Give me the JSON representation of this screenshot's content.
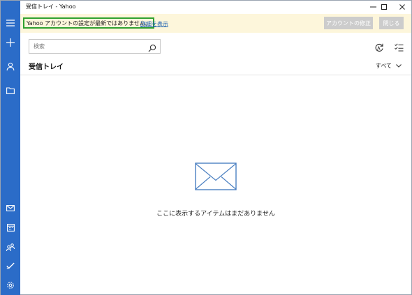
{
  "window": {
    "title": "受信トレイ - Yahoo"
  },
  "rail": {
    "top_icons": [
      "hamburger-icon",
      "plus-icon",
      "person-icon",
      "folder-icon"
    ],
    "bottom_icons": [
      "mail-icon",
      "calendar-icon",
      "people-icon",
      "todo-icon",
      "settings-icon"
    ]
  },
  "notification": {
    "message": "Yahoo アカウントの設定が最新ではありません。",
    "link": "詳細を表示",
    "fix_button": "アカウントの修正",
    "close_button": "閉じる",
    "highlight_color": "#2fa12f",
    "background_color": "#fdf6db"
  },
  "search": {
    "placeholder": "検索"
  },
  "folder": {
    "title": "受信トレイ",
    "filter": "すべて"
  },
  "empty_state": {
    "message": "ここに表示するアイテムはまだありません"
  },
  "colors": {
    "rail": "#2b6cc8",
    "accent": "#4a7fc1"
  }
}
